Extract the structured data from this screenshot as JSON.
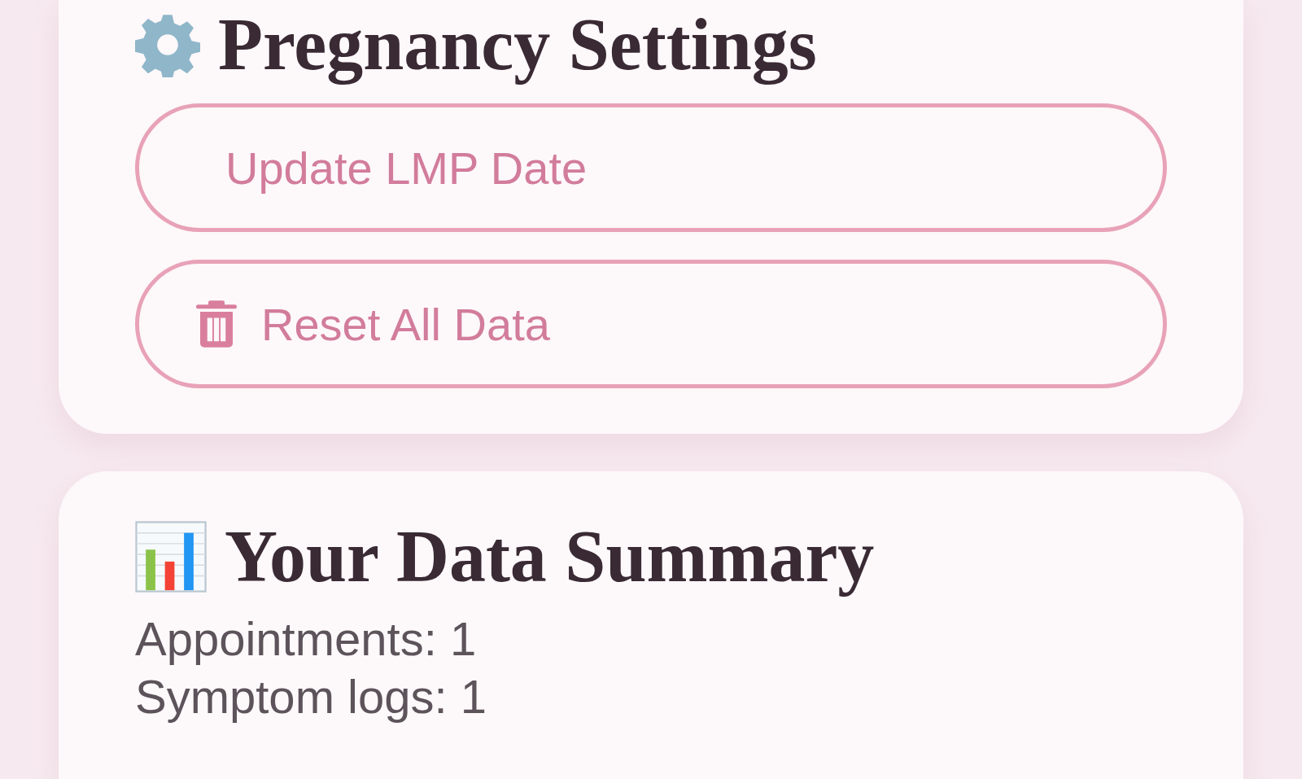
{
  "settings": {
    "title": "Pregnancy Settings",
    "buttons": [
      {
        "kind": "plain",
        "label": "Update LMP Date"
      },
      {
        "kind": "delete",
        "label": "Reset All Data"
      }
    ]
  },
  "summary": {
    "title": "Your Data Summary",
    "stats": [
      "Appointments: 1",
      "Symptom logs: 1"
    ]
  }
}
